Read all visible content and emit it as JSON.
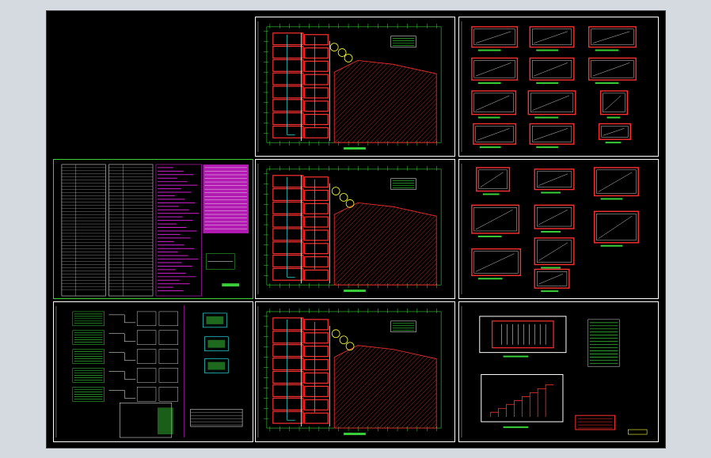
{
  "drawing": {
    "background": "#000000",
    "frame_color": "#ffffff",
    "note_color": "#39d13a",
    "wall_color": "#ff3030",
    "hatch_color": "#d03030",
    "dimension_color": "#39d13a",
    "accent_yellow": "#ffff33",
    "accent_cyan": "#33ffff",
    "legend_magenta": "#d020d0"
  },
  "sheets": [
    {
      "id": "floor-plan-1",
      "type": "floor-plan"
    },
    {
      "id": "room-details-1",
      "type": "detail-sheet"
    },
    {
      "id": "legend-notes",
      "type": "notes-sheet"
    },
    {
      "id": "floor-plan-2",
      "type": "floor-plan"
    },
    {
      "id": "room-details-2",
      "type": "detail-sheet"
    },
    {
      "id": "system-diagrams",
      "type": "schedule-sheet"
    },
    {
      "id": "floor-plan-3",
      "type": "floor-plan"
    },
    {
      "id": "section-details",
      "type": "detail-sheet"
    }
  ]
}
